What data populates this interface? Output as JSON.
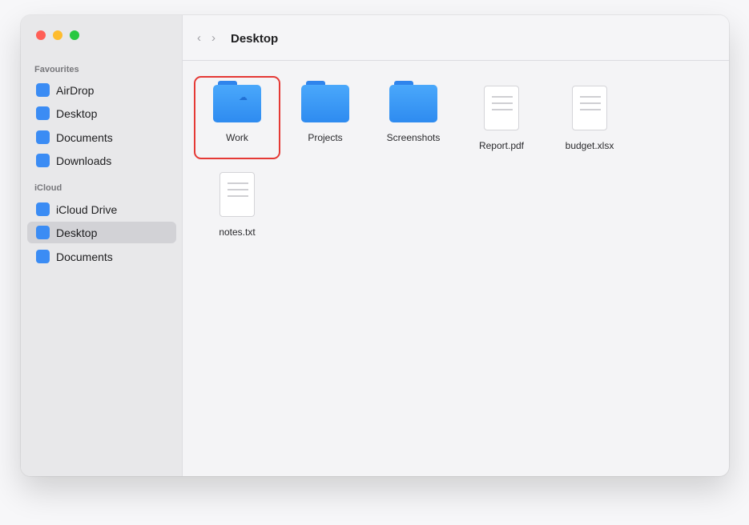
{
  "window": {
    "traffic_lights": [
      "close",
      "minimize",
      "zoom"
    ]
  },
  "sidebar": {
    "sections": [
      {
        "title": "Favourites",
        "items": [
          {
            "label": "AirDrop"
          },
          {
            "label": "Desktop"
          },
          {
            "label": "Documents"
          },
          {
            "label": "Downloads"
          }
        ]
      },
      {
        "title": "iCloud",
        "items": [
          {
            "label": "iCloud Drive"
          },
          {
            "label": "Desktop",
            "selected": true
          },
          {
            "label": "Documents"
          }
        ]
      }
    ]
  },
  "toolbar": {
    "back_icon": "‹",
    "forward_icon": "›",
    "title": "Desktop"
  },
  "files": [
    {
      "name": "Work",
      "kind": "folder",
      "icloud": true,
      "highlighted": true
    },
    {
      "name": "Projects",
      "kind": "folder"
    },
    {
      "name": "Screenshots",
      "kind": "folder"
    },
    {
      "name": "Report.pdf",
      "kind": "document"
    },
    {
      "name": "budget.xlsx",
      "kind": "document"
    },
    {
      "name": "notes.txt",
      "kind": "document"
    }
  ],
  "colors": {
    "accent": "#3b8cf4",
    "highlight_border": "#e53935"
  }
}
